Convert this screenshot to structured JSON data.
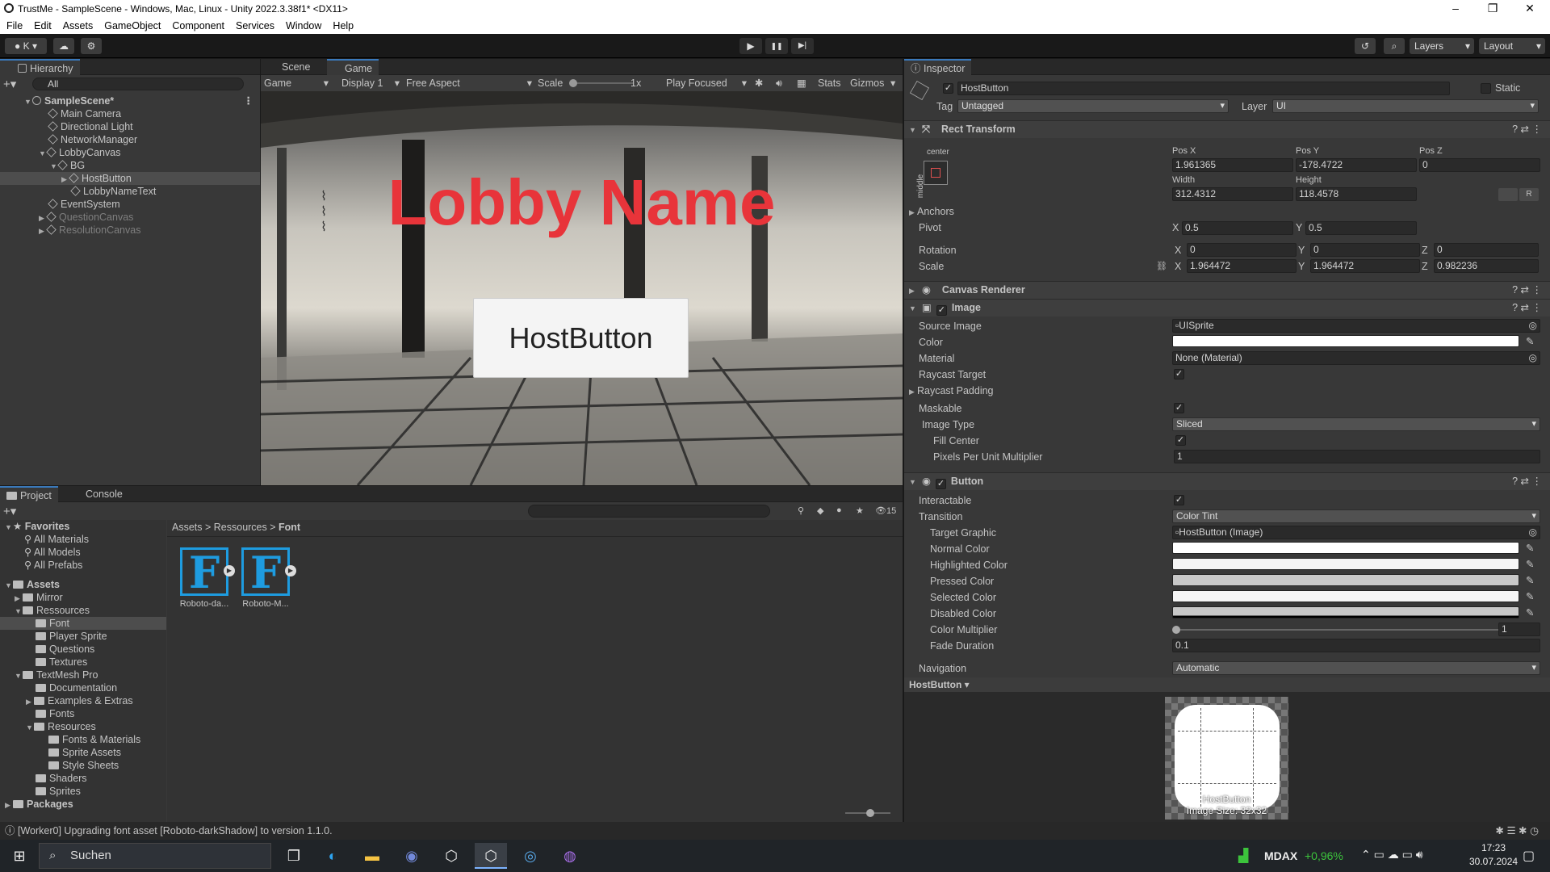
{
  "window": {
    "title": "TrustMe - SampleScene - Windows, Mac, Linux - Unity 2022.3.38f1* <DX11>",
    "min": "–",
    "max": "❐",
    "close": "✕"
  },
  "menu": [
    "File",
    "Edit",
    "Assets",
    "GameObject",
    "Component",
    "Services",
    "Window",
    "Help"
  ],
  "toolbar": {
    "account": "K",
    "layers": "Layers",
    "layout": "Layout",
    "play": "▶",
    "pause": "❚❚",
    "step": "▶|"
  },
  "hierarchy": {
    "tab": "Hierarchy",
    "search_placeholder": "All",
    "items": [
      {
        "label": "SampleScene*"
      },
      {
        "label": "Main Camera"
      },
      {
        "label": "Directional Light"
      },
      {
        "label": "NetworkManager"
      },
      {
        "label": "LobbyCanvas"
      },
      {
        "label": "BG"
      },
      {
        "label": "HostButton"
      },
      {
        "label": "LobbyNameText"
      },
      {
        "label": "EventSystem"
      },
      {
        "label": "QuestionCanvas"
      },
      {
        "label": "ResolutionCanvas"
      }
    ]
  },
  "game": {
    "tabs": [
      "Scene",
      "Game"
    ],
    "bar": {
      "mode": "Game",
      "display": "Display 1",
      "aspect": "Free Aspect",
      "scale_label": "Scale",
      "scale_value": "1x",
      "play_focused": "Play Focused",
      "stats": "Stats",
      "gizmos": "Gizmos"
    },
    "lobby_name": "Lobby Name",
    "host_button": "HostButton"
  },
  "project": {
    "tabs": [
      "Project",
      "Console"
    ],
    "count": "15",
    "breadcrumb": [
      "Assets",
      "Ressources",
      "Font"
    ],
    "favorites_label": "Favorites",
    "favorites": [
      "All Materials",
      "All Models",
      "All Prefabs"
    ],
    "assets_label": "Assets",
    "tree": [
      {
        "label": "Mirror",
        "depth": 1
      },
      {
        "label": "Ressources",
        "depth": 1
      },
      {
        "label": "Font",
        "depth": 2
      },
      {
        "label": "Player Sprite",
        "depth": 2
      },
      {
        "label": "Questions",
        "depth": 2
      },
      {
        "label": "Textures",
        "depth": 2
      },
      {
        "label": "TextMesh Pro",
        "depth": 1
      },
      {
        "label": "Documentation",
        "depth": 2
      },
      {
        "label": "Examples & Extras",
        "depth": 2
      },
      {
        "label": "Fonts",
        "depth": 2
      },
      {
        "label": "Resources",
        "depth": 2
      },
      {
        "label": "Fonts & Materials",
        "depth": 3
      },
      {
        "label": "Sprite Assets",
        "depth": 3
      },
      {
        "label": "Style Sheets",
        "depth": 3
      },
      {
        "label": "Shaders",
        "depth": 2
      },
      {
        "label": "Sprites",
        "depth": 2
      }
    ],
    "packages_label": "Packages",
    "files": [
      "Roboto-da...",
      "Roboto-M..."
    ]
  },
  "inspector": {
    "tab": "Inspector",
    "object_name": "HostButton",
    "static_label": "Static",
    "tag_label": "Tag",
    "tag_value": "Untagged",
    "layer_label": "Layer",
    "layer_value": "UI",
    "rect": {
      "title": "Rect Transform",
      "anchor_h": "center",
      "anchor_v": "middle",
      "posx_label": "Pos X",
      "posx": "1.961365",
      "posy_label": "Pos Y",
      "posy": "-178.4722",
      "posz_label": "Pos Z",
      "posz": "0",
      "width_label": "Width",
      "width": "312.4312",
      "height_label": "Height",
      "height": "118.4578",
      "anchors": "Anchors",
      "pivot": "Pivot",
      "pivot_x": "0.5",
      "pivot_y": "0.5",
      "rotation": "Rotation",
      "rot_x": "0",
      "rot_y": "0",
      "rot_z": "0",
      "scale": "Scale",
      "scale_x": "1.964472",
      "scale_y": "1.964472",
      "scale_z": "0.982236",
      "r_btn": "R"
    },
    "canvas_renderer": "Canvas Renderer",
    "image": {
      "title": "Image",
      "source_label": "Source Image",
      "source": "UISprite",
      "color_label": "Color",
      "material_label": "Material",
      "material": "None (Material)",
      "raycast_target": "Raycast Target",
      "raycast_padding": "Raycast Padding",
      "maskable": "Maskable",
      "image_type_label": "Image Type",
      "image_type": "Sliced",
      "fill_center": "Fill Center",
      "ppu_label": "Pixels Per Unit Multiplier",
      "ppu": "1"
    },
    "button": {
      "title": "Button",
      "interactable": "Interactable",
      "transition_label": "Transition",
      "transition": "Color Tint",
      "target_label": "Target Graphic",
      "target": "HostButton (Image)",
      "normal": "Normal Color",
      "highlighted": "Highlighted Color",
      "pressed": "Pressed Color",
      "selected": "Selected Color",
      "disabled": "Disabled Color",
      "multiplier_label": "Color Multiplier",
      "multiplier": "1",
      "fade_label": "Fade Duration",
      "fade": "0.1",
      "navigation_label": "Navigation",
      "navigation": "Automatic"
    },
    "preview": {
      "title": "HostButton",
      "caption1": "HostButton",
      "caption2": "Image Size: 32x32"
    }
  },
  "status": "[Worker0] Upgrading font asset [Roboto-darkShadow] to version 1.1.0.",
  "taskbar": {
    "search": "Suchen",
    "ticker": "MDAX",
    "change": "+0,96%",
    "time": "17:23",
    "date": "30.07.2024"
  },
  "colors": {
    "accent": "#3a79bb",
    "lobby_red": "#e8343a",
    "file_icon": "#1e9ce0",
    "ticker_green": "#3cc43c"
  }
}
